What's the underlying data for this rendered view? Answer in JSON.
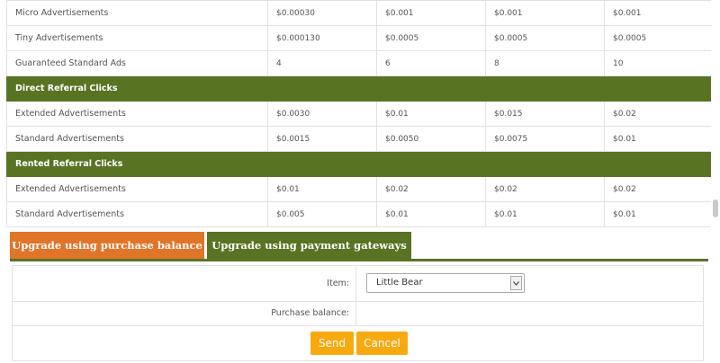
{
  "colors": {
    "section_green": "#587423",
    "tab_orange": "#e0752a",
    "tab_green": "#587423",
    "button_orange": "#f7a910"
  },
  "rows_top": [
    {
      "label": "Micro Advertisements",
      "values": [
        "$0.00030",
        "$0.001",
        "$0.001",
        "$0.001"
      ]
    },
    {
      "label": "Tiny Advertisements",
      "values": [
        "$0.000130",
        "$0.0005",
        "$0.0005",
        "$0.0005"
      ]
    },
    {
      "label": "Guaranteed Standard Ads",
      "values": [
        "4",
        "6",
        "8",
        "10"
      ]
    }
  ],
  "section_direct": {
    "title": "Direct Referral Clicks",
    "rows": [
      {
        "label": "Extended Advertisements",
        "values": [
          "$0.0030",
          "$0.01",
          "$0.015",
          "$0.02"
        ]
      },
      {
        "label": "Standard Advertisements",
        "values": [
          "$0.0015",
          "$0.0050",
          "$0.0075",
          "$0.01"
        ]
      }
    ]
  },
  "section_rented": {
    "title": "Rented Referral Clicks",
    "rows": [
      {
        "label": "Extended Advertisements",
        "values": [
          "$0.01",
          "$0.02",
          "$0.02",
          "$0.02"
        ]
      },
      {
        "label": "Standard Advertisements",
        "values": [
          "$0.005",
          "$0.01",
          "$0.01",
          "$0.01"
        ]
      }
    ]
  },
  "tabs": {
    "purchase_balance": "Upgrade using purchase balance",
    "payment_gateways": "Upgrade using payment gateways"
  },
  "form": {
    "item_label": "Item:",
    "item_value": "Little Bear",
    "balance_label": "Purchase balance:",
    "balance_value": "",
    "send_label": "Send",
    "cancel_label": "Cancel"
  }
}
